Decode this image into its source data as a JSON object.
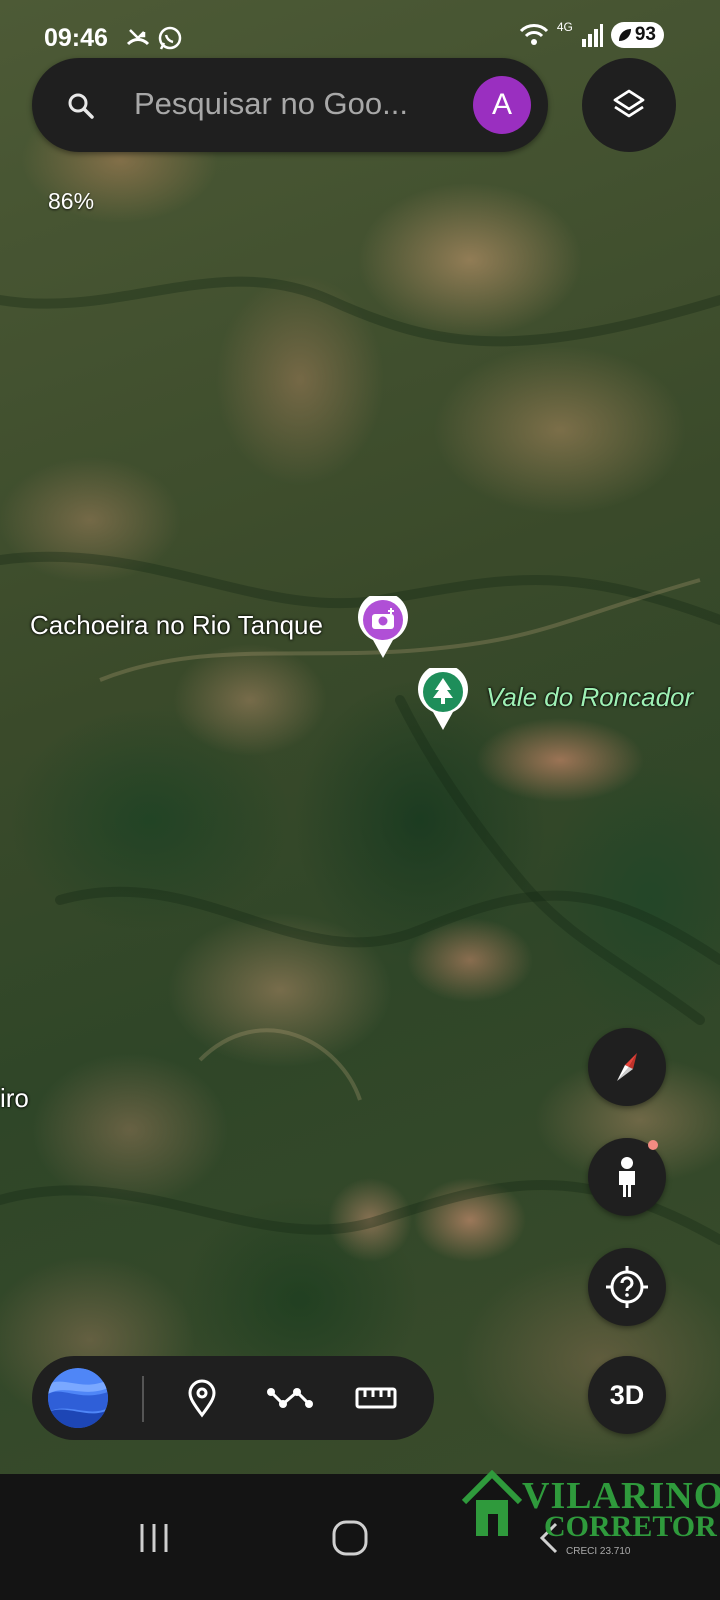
{
  "status_bar": {
    "time": "09:46",
    "network": "4G",
    "battery": "93"
  },
  "search": {
    "placeholder": "Pesquisar no Goo..."
  },
  "account": {
    "avatar_letter": "A",
    "avatar_color": "#9a2fc0"
  },
  "map": {
    "zoom": "86%",
    "labels": {
      "waterfall": "Cachoeira no Rio Tanque",
      "park": "Vale do Roncador",
      "partial": "iro"
    },
    "pins": {
      "waterfall_pin": {
        "icon": "camera-icon",
        "color": "#b04fd6"
      },
      "park_pin": {
        "icon": "tree-icon",
        "color": "#1e8e5a"
      }
    }
  },
  "controls": {
    "three_d": "3D",
    "compass": "compass-icon",
    "street_view": "pegman-icon",
    "voyager": "help-icon"
  },
  "toolbar": {
    "items": [
      "earth-icon",
      "place-pin-icon",
      "path-icon",
      "ruler-icon"
    ]
  },
  "watermark": {
    "line1": "VILARINO",
    "line2": "CORRETOR",
    "line3": "CRECI 23.710",
    "color": "#2f9a3c"
  }
}
